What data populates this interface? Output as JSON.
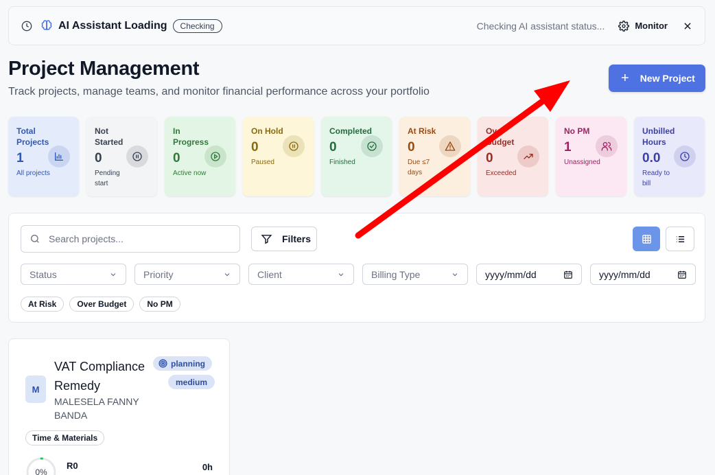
{
  "banner": {
    "title": "AI Assistant Loading",
    "badge": "Checking",
    "status_text": "Checking AI assistant status...",
    "monitor_label": "Monitor"
  },
  "header": {
    "title": "Project Management",
    "subtitle": "Track projects, manage teams, and monitor financial performance across your portfolio",
    "new_project_label": "New Project"
  },
  "stats": [
    {
      "label": "Total Projects",
      "value": "1",
      "sub": "All projects",
      "icon": "bar-chart-icon",
      "bg": "#e4ecfb",
      "fg": "#3056b6"
    },
    {
      "label": "Not Started",
      "value": "0",
      "sub": "Pending start",
      "icon": "pause-circle-icon",
      "bg": "#f3f4f6",
      "fg": "#374151"
    },
    {
      "label": "In Progress",
      "value": "0",
      "sub": "Active now",
      "icon": "play-circle-icon",
      "bg": "#e3f6e5",
      "fg": "#2f7a3a"
    },
    {
      "label": "On Hold",
      "value": "0",
      "sub": "Paused",
      "icon": "pause-circle-icon",
      "bg": "#fdf6d8",
      "fg": "#8a6a0a"
    },
    {
      "label": "Completed",
      "value": "0",
      "sub": "Finished",
      "icon": "check-circle-icon",
      "bg": "#e4f6ea",
      "fg": "#226b3d"
    },
    {
      "label": "At Risk",
      "value": "0",
      "sub": "Due ≤7 days",
      "icon": "warning-icon",
      "bg": "#fcefdf",
      "fg": "#9a4a10"
    },
    {
      "label": "Over Budget",
      "value": "0",
      "sub": "Exceeded",
      "icon": "trending-up-icon",
      "bg": "#fae6e4",
      "fg": "#9b2c25"
    },
    {
      "label": "No PM",
      "value": "1",
      "sub": "Unassigned",
      "icon": "users-icon",
      "bg": "#fbe8f2",
      "fg": "#9b2463"
    },
    {
      "label": "Unbilled Hours",
      "value": "0.0",
      "sub": "Ready to bill",
      "icon": "clock-icon",
      "bg": "#e8e9fb",
      "fg": "#3b3fa8"
    }
  ],
  "filters": {
    "search_placeholder": "Search projects...",
    "filters_label": "Filters",
    "selects": [
      "Status",
      "Priority",
      "Client",
      "Billing Type"
    ],
    "date_placeholder": "yyyy/mm/dd",
    "chips": [
      "At Risk",
      "Over Budget",
      "No PM"
    ]
  },
  "project": {
    "initial": "M",
    "name": "VAT Compliance Remedy",
    "client": "MALESELA FANNY BANDA",
    "status": "planning",
    "priority": "medium",
    "billing": "Time & Materials",
    "progress": 0,
    "progress_label": "0%",
    "amount": "R0",
    "hours": "0h"
  },
  "annotation_color": "#ff0000"
}
